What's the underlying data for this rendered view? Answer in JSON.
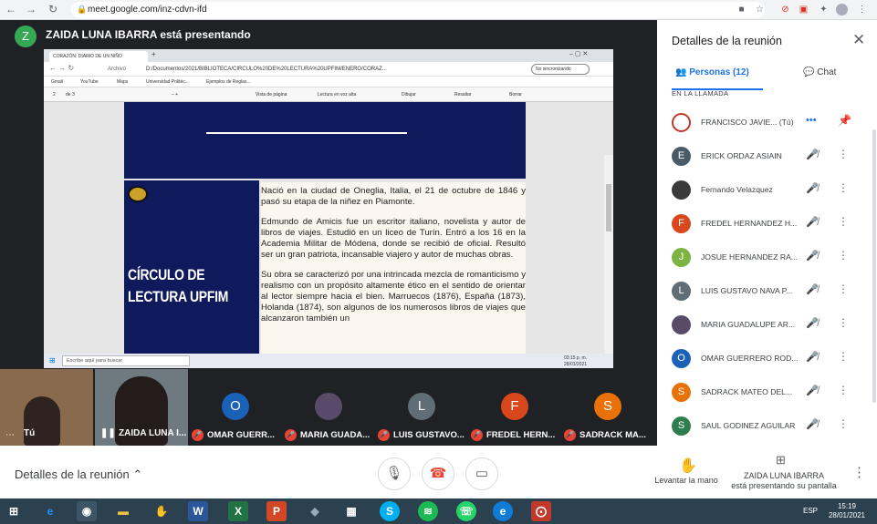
{
  "browser": {
    "url": "meet.google.com/inz-cdvn-ifd"
  },
  "presenting": {
    "avatar_letter": "Z",
    "title": "ZAIDA LUNA IBARRA está presentando"
  },
  "shared": {
    "tab_title": "CORAZÓN: DIARIO DE UN NIÑO",
    "address_label": "Archivo",
    "address": "D:/Documentos/2021/BIBLIOTECA/CIRCULO%20DE%20LECTURA%20UPFIM/ENERO/CORAZ...",
    "sync": "No sincronizando",
    "bookmarks": [
      "Gmail",
      "YouTube",
      "Maps",
      "Universidad Politéc...",
      "Ejemplos de Reglas..."
    ],
    "page": "2",
    "page_total": "de 3",
    "toolbar": [
      "Vista de página",
      "Lectura en voz alta",
      "Dibujar",
      "Resaltar",
      "Borrar"
    ],
    "side_title": "CÍRCULO DE LECTURA UPFIM",
    "paragraphs": [
      "Nació en la ciudad de Oneglia, Italia, el 21 de octubre de 1846 y pasó su etapa de la niñez en Piamonte.",
      "Edmundo de Amicis fue un escritor italiano, novelista y autor de libros de viajes. Estudió en un liceo de Turín. Entró a los 16 en la Academia Militar de Módena, donde se recibió de oficial. Resultó ser un gran patriota, incansable viajero y autor de muchas obras.",
      "Su obra se caracterizó por una intrincada mezcla de romanticismo y realismo con un propósito altamente ético en el sentido de orientar al lector siempre hacia el bien. Marruecos (1876), España (1873), Holanda (1874), son algunos de los numerosos libros de viajes que alcanzaron también un"
    ],
    "taskbar_search": "Escribe aquí para buscar",
    "taskbar_time": "03:15 p. m.",
    "taskbar_date": "28/01/2021"
  },
  "strip": {
    "self_label": "Tú",
    "zaida_label": "ZAIDA LUNA I...",
    "tiles": [
      {
        "letter": "O",
        "color": "#1a62b8",
        "name": "OMAR GUERR..."
      },
      {
        "letter": "",
        "color": "#5a4a6a",
        "name": "MARIA GUADA..."
      },
      {
        "letter": "L",
        "color": "#5f6d77",
        "name": "LUIS GUSTAVO..."
      },
      {
        "letter": "F",
        "color": "#d9481c",
        "name": "FREDEL HERN..."
      },
      {
        "letter": "S",
        "color": "#e8710a",
        "name": "SADRACK MA..."
      }
    ]
  },
  "bottom": {
    "details": "Detalles de la reunión",
    "raise_hand": "Levantar la mano",
    "presenting_name": "ZAIDA LUNA IBARRA",
    "presenting_sub": "está presentando su pantalla"
  },
  "panel": {
    "title": "Detalles de la reunión",
    "tab_people": "Personas (12)",
    "tab_chat": "Chat",
    "in_call": "EN LA LLAMADA",
    "people": [
      {
        "letter": "",
        "color": "#c0392b",
        "name": "FRANCISCO JAVIE...",
        "suffix": "(Tú)"
      },
      {
        "letter": "E",
        "color": "#4a5a66",
        "name": "ERICK ORDAZ ASIAIN"
      },
      {
        "letter": "",
        "color": "#3a3a3a",
        "name": "Fernando Velazquez"
      },
      {
        "letter": "F",
        "color": "#d9481c",
        "name": "FREDEL HERNANDEZ H..."
      },
      {
        "letter": "J",
        "color": "#7cb342",
        "name": "JOSUE HERNANDEZ RA..."
      },
      {
        "letter": "L",
        "color": "#5f6d77",
        "name": "LUIS GUSTAVO NAVA P..."
      },
      {
        "letter": "",
        "color": "#5a4a6a",
        "name": "MARIA GUADALUPE AR..."
      },
      {
        "letter": "O",
        "color": "#1a62b8",
        "name": "OMAR GUERRERO ROD..."
      },
      {
        "letter": "S",
        "color": "#e8710a",
        "name": "SADRACK MATEO DEL..."
      },
      {
        "letter": "S",
        "color": "#2e7d4f",
        "name": "SAUL GODINEZ AGUILAR"
      }
    ]
  },
  "taskbar": {
    "lang": "ESP",
    "time": "15:19",
    "date": "28/01/2021"
  }
}
